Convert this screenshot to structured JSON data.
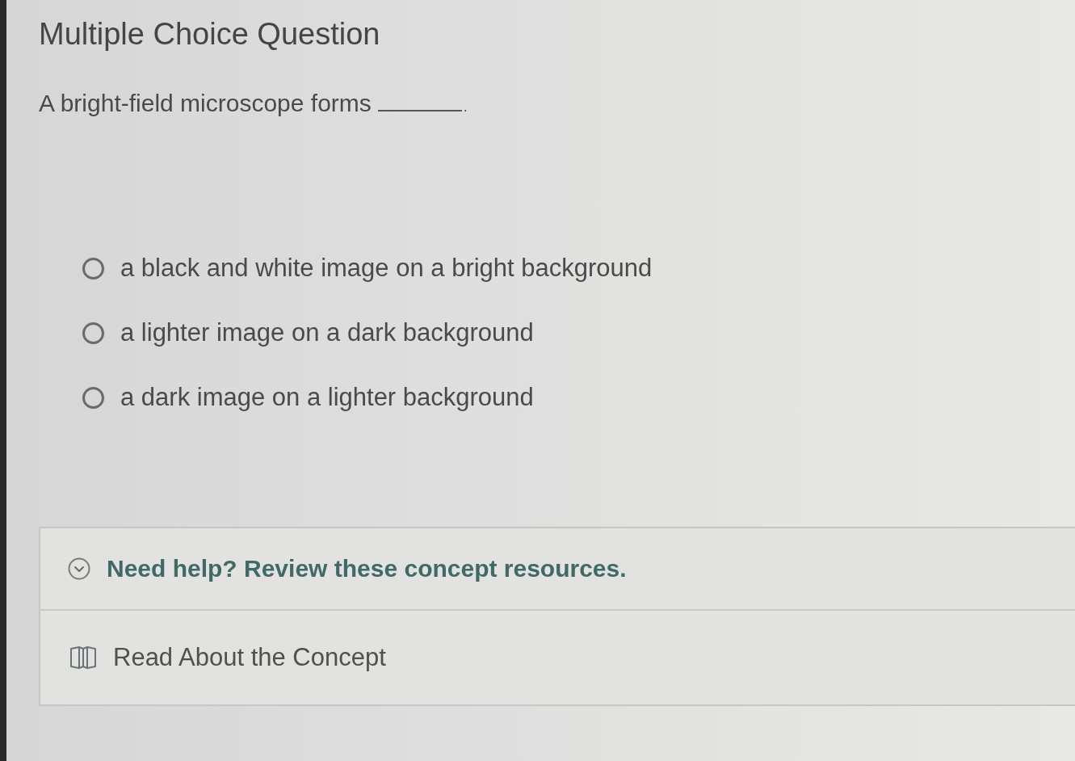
{
  "header": {
    "title": "Multiple Choice Question"
  },
  "question": {
    "prompt": "A bright-field microscope forms",
    "after_blank": "."
  },
  "options": [
    {
      "label": "a black and white image on a bright background",
      "selected": false
    },
    {
      "label": "a lighter image on a dark background",
      "selected": false
    },
    {
      "label": "a dark image on a lighter background",
      "selected": false
    }
  ],
  "help": {
    "title": "Need help? Review these concept resources.",
    "expanded": true,
    "resources": [
      {
        "label": "Read About the Concept"
      }
    ]
  }
}
